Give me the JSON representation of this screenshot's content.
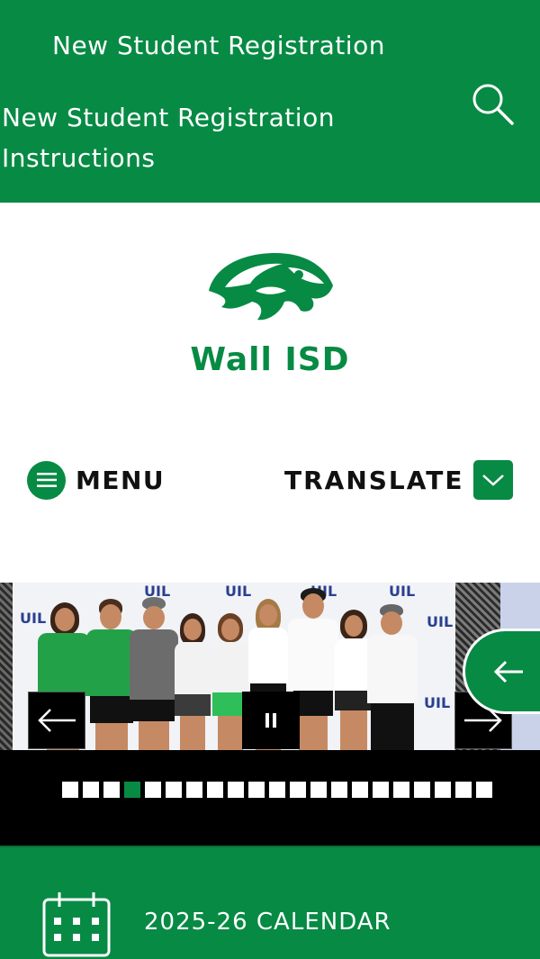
{
  "header": {
    "link_1": "New Student Registration",
    "link_2": "New Student Registration Instructions",
    "search_icon": "search-icon"
  },
  "branding": {
    "district_name": "Wall ISD",
    "logo_icon": "eagle-head-logo",
    "brand_color": "#078a44"
  },
  "nav": {
    "menu_label": "MENU",
    "menu_icon": "hamburger-icon",
    "translate_label": "TRANSLATE",
    "translate_icon": "chevron-down-icon"
  },
  "slideshow": {
    "banner_text": "UIL",
    "prev_icon": "arrow-left-icon",
    "next_icon": "arrow-right-icon",
    "pause_icon": "pause-icon",
    "dot_count": 21,
    "active_dot": 4
  },
  "side_tab": {
    "icon": "arrow-left-icon"
  },
  "quick_link": {
    "label": "2025-26 CALENDAR",
    "icon": "calendar-icon"
  }
}
